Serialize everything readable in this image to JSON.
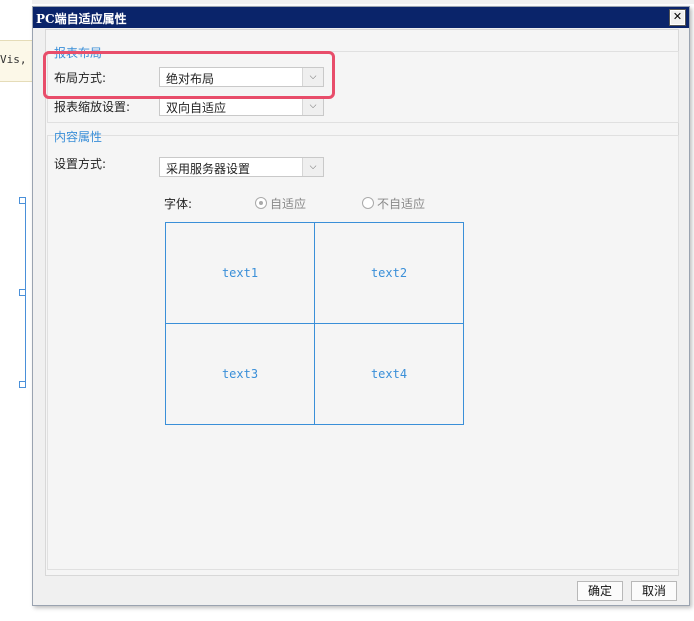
{
  "background": {
    "code_fragment": "Vis,"
  },
  "dialog": {
    "title": "PC端自适应属性",
    "close_glyph": "✕",
    "report_layout": {
      "group_title": "报表布局",
      "layout_mode_label": "布局方式:",
      "layout_mode_value": "绝对布局",
      "zoom_label": "报表缩放设置:",
      "zoom_value": "双向自适应"
    },
    "content_props": {
      "group_title": "内容属性",
      "setting_label": "设置方式:",
      "setting_value": "采用服务器设置",
      "font_label": "字体:",
      "radio_adaptive": "自适应",
      "radio_not_adaptive": "不自适应",
      "radio_selected": "自适应",
      "preview_cells": [
        "text1",
        "text2",
        "text3",
        "text4"
      ]
    },
    "ok_label": "确定",
    "cancel_label": "取消"
  },
  "colors": {
    "title_bar": "#0a246a",
    "accent_blue": "#3a8fd8",
    "highlight_red": "#e84d6a"
  }
}
